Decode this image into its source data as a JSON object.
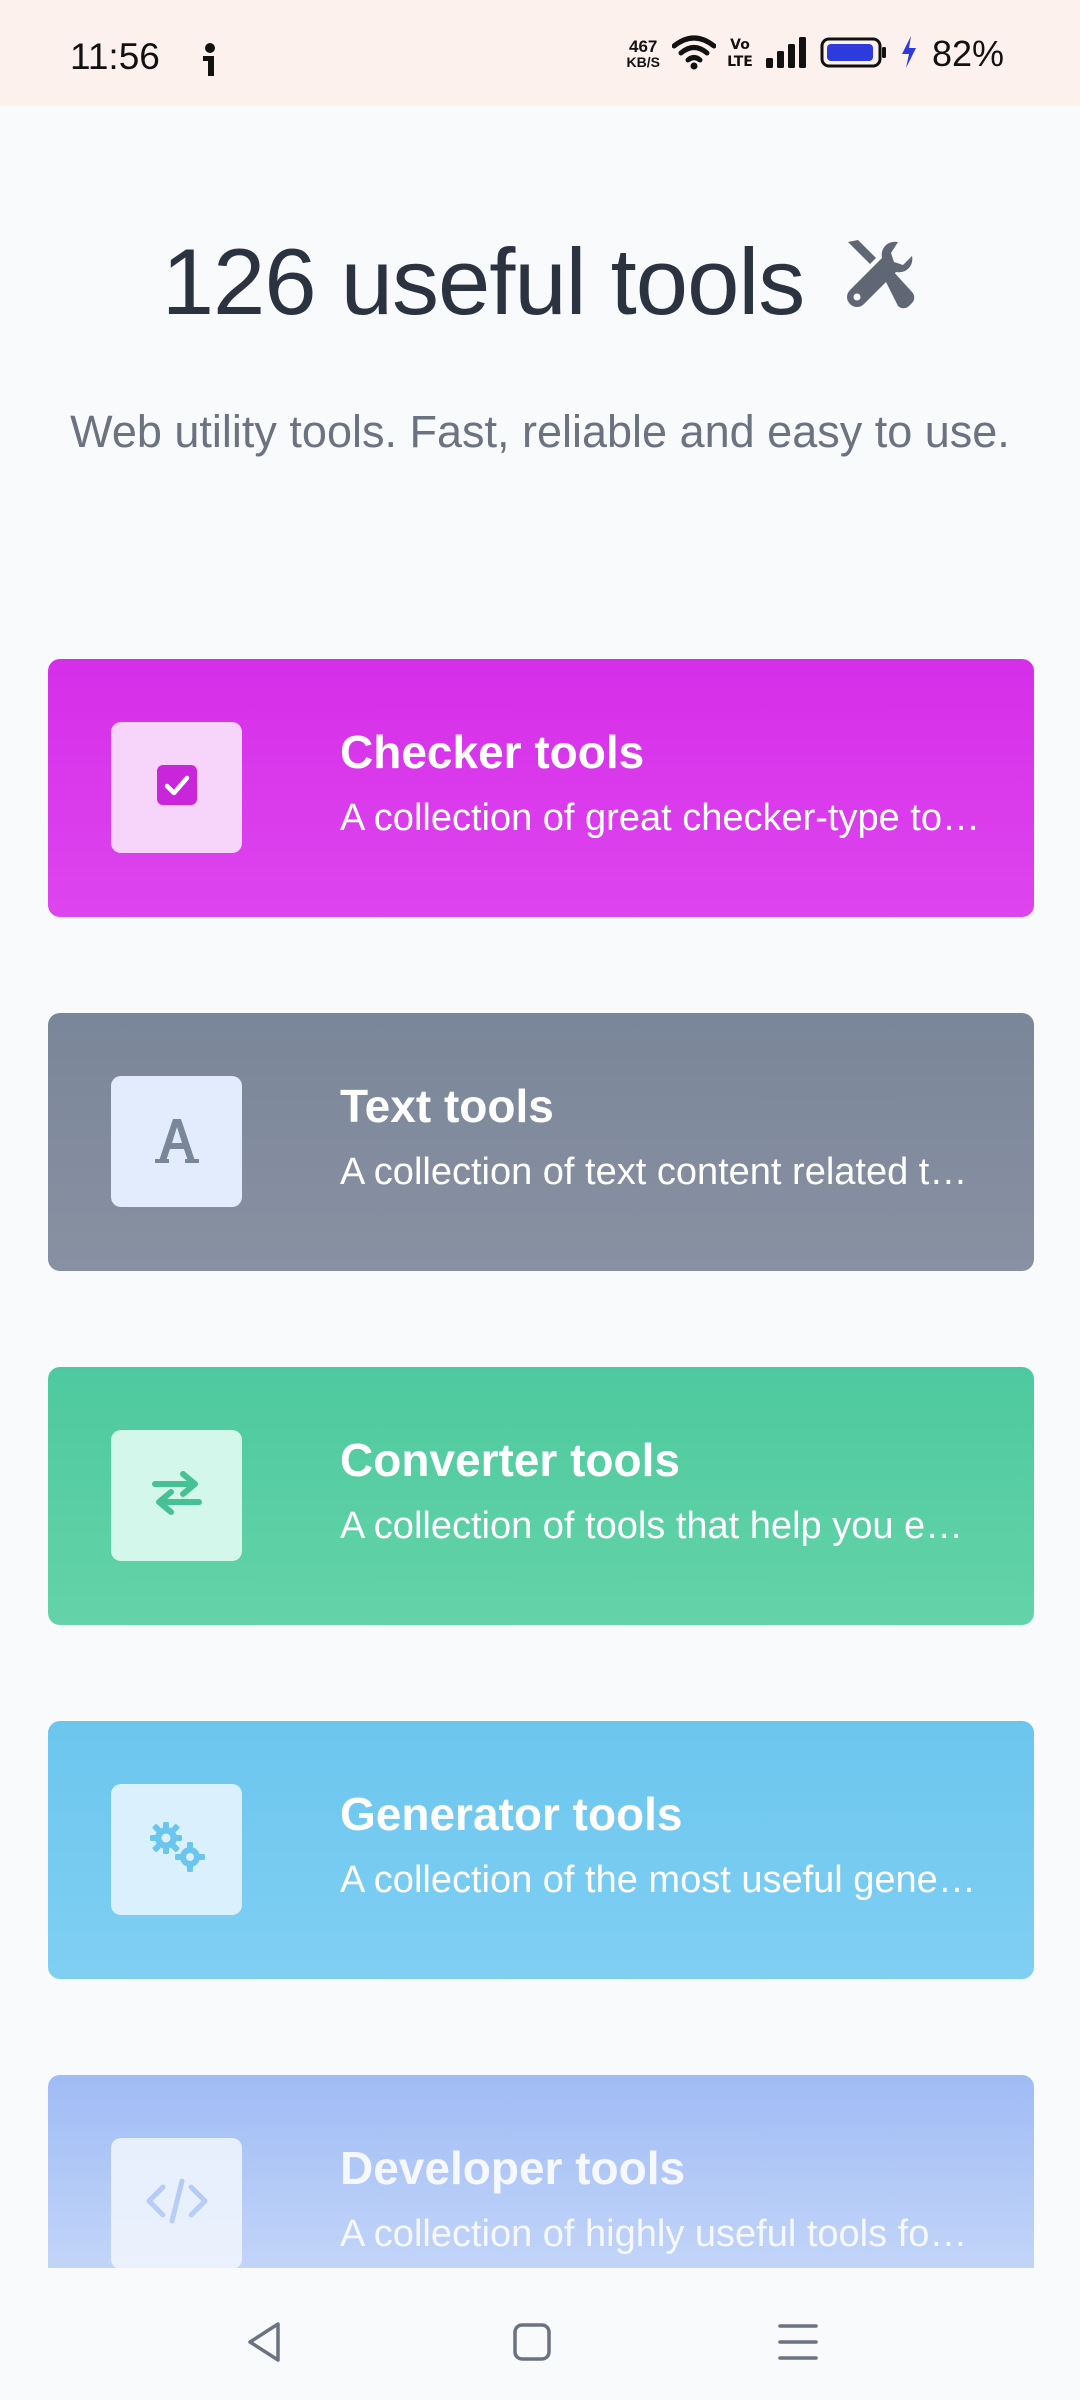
{
  "status_bar": {
    "time": "11:56",
    "net_speed_value": "467",
    "net_speed_unit": "KB/S",
    "volte_label": "Vo LTE",
    "battery_percent": "82%",
    "icons": [
      "info-icon",
      "wifi-icon",
      "volte-icon",
      "signal-icon",
      "battery-icon",
      "charging-icon"
    ]
  },
  "hero": {
    "title": "126 useful tools",
    "title_icon": "tools-icon",
    "subtitle": "Web utility tools. Fast, reliable and easy to use."
  },
  "categories": [
    {
      "title": "Checker tools",
      "description": "A collection of great checker-type tools",
      "icon": "checkbox-icon",
      "color": "#d62ee9"
    },
    {
      "title": "Text tools",
      "description": "A collection of text content related tools",
      "icon": "font-icon",
      "color": "#7a8699"
    },
    {
      "title": "Converter tools",
      "description": "A collection of tools that help you easily convert",
      "icon": "exchange-icon",
      "color": "#4ec99f"
    },
    {
      "title": "Generator tools",
      "description": "A collection of the most useful generators",
      "icon": "cogs-icon",
      "color": "#6bc6ee"
    },
    {
      "title": "Developer tools",
      "description": "A collection of highly useful tools for developers",
      "icon": "code-icon",
      "color": "#9dbaf5"
    }
  ],
  "nav_bar": {
    "buttons": [
      "back-icon",
      "home-icon",
      "menu-icon"
    ]
  }
}
